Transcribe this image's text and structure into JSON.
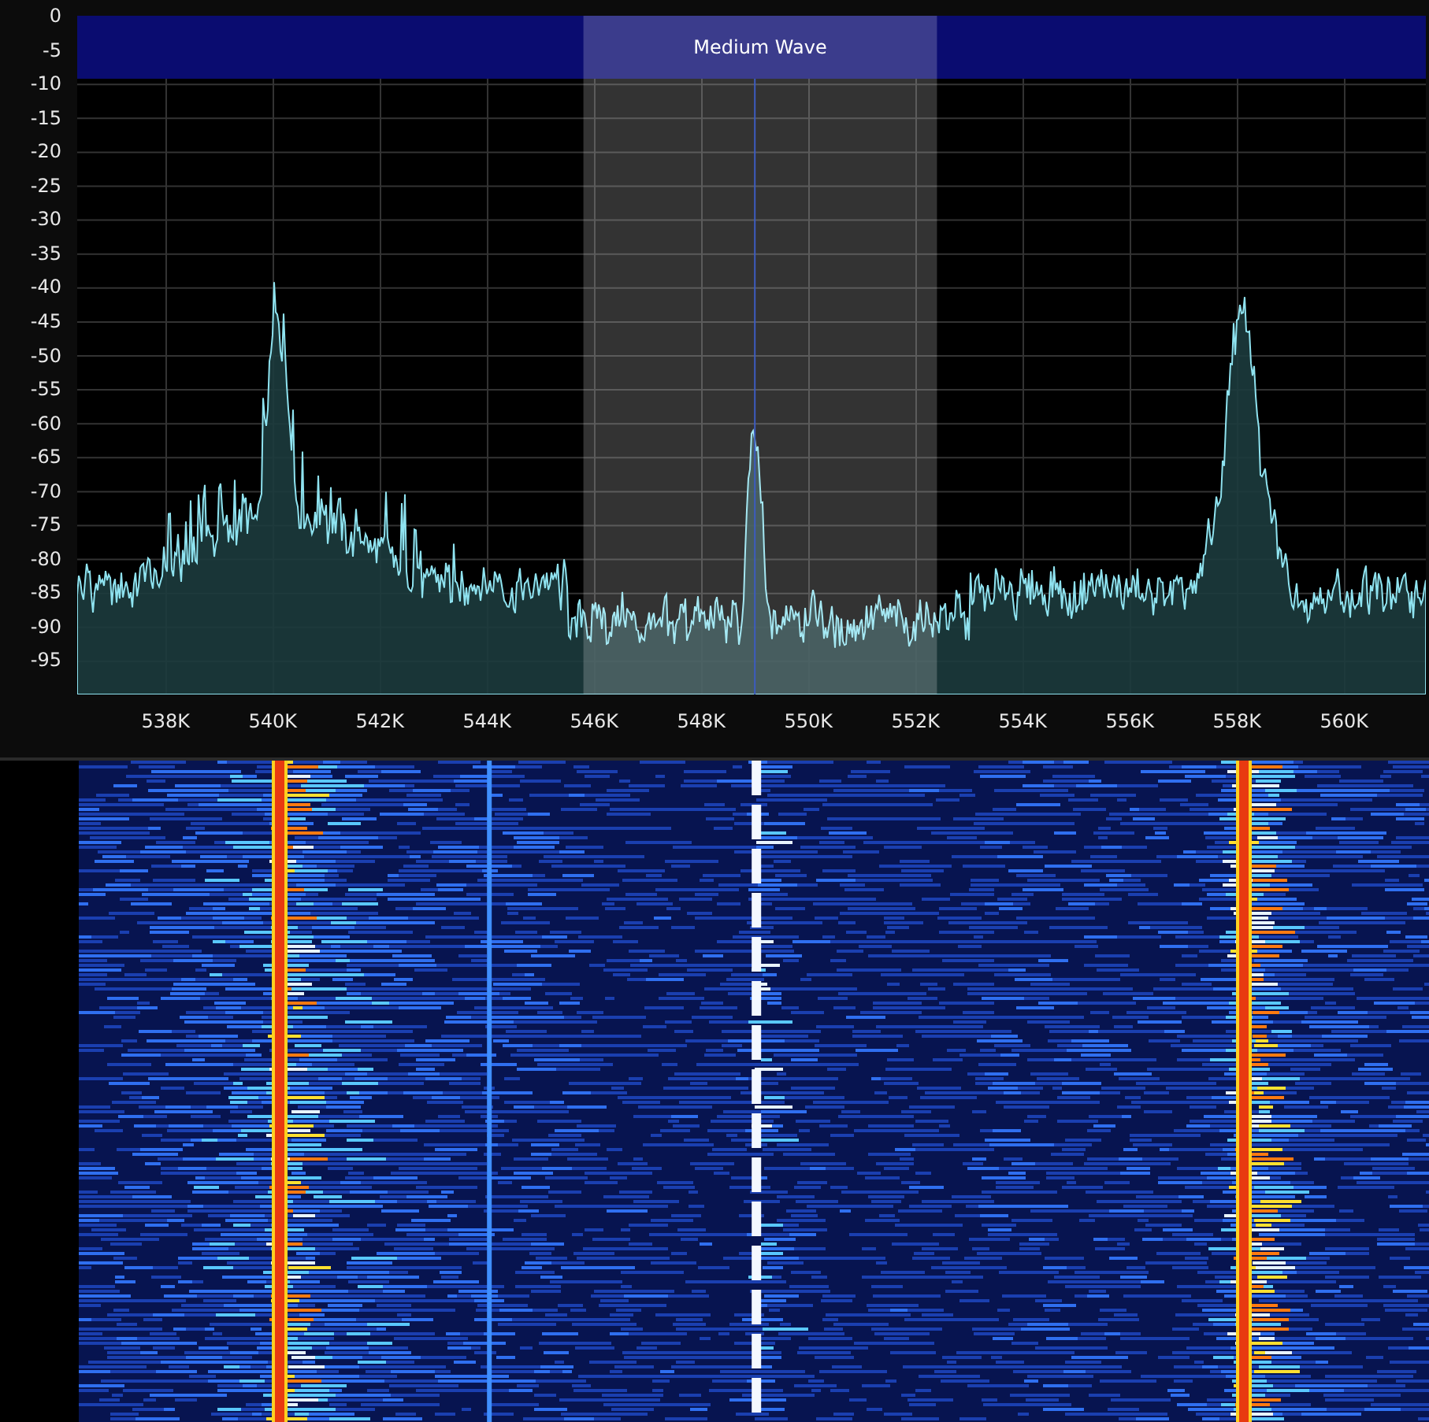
{
  "spectrum": {
    "band_label": "Medium Wave",
    "y_axis_labels": [
      "0",
      "-5",
      "-10",
      "-15",
      "-20",
      "-25",
      "-30",
      "-35",
      "-40",
      "-45",
      "-50",
      "-55",
      "-60",
      "-65",
      "-70",
      "-75",
      "-80",
      "-85",
      "-90",
      "-95"
    ],
    "x_axis_labels": [
      "538K",
      "540K",
      "542K",
      "544K",
      "546K",
      "548K",
      "550K",
      "552K",
      "554K",
      "556K",
      "558K",
      "560K"
    ]
  }
}
